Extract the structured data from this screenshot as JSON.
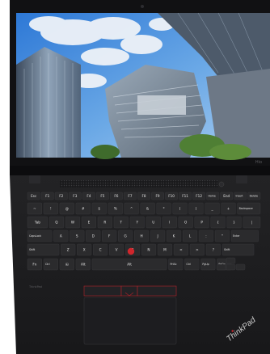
{
  "photo": {
    "subject": "Top view of a black ThinkPad laptop, opened flat, showing the keyboard, TrackPoint and touchpad; the screen shows an upward view of glass skyscrapers against a blue sky with white clouds",
    "colors": {
      "body": "#1c1c1e",
      "key": "#2b2b2d",
      "key_legend": "#e4e4e4",
      "trackpoint": "#d0262c",
      "trackpad_accent": "#b3222a",
      "sky": "#4a8fd8",
      "cloud": "#eef2f8"
    }
  },
  "screen": {
    "bezel_text": "Hio",
    "wallpaper": "skyscrapers-under-blue-sky"
  },
  "keyboard": {
    "function_row": [
      "Esc",
      "F1",
      "F2",
      "F3",
      "F4",
      "F5",
      "F6",
      "F7",
      "F8",
      "F9",
      "F10",
      "F11",
      "F12",
      "Home",
      "End",
      "Insert",
      "Delete"
    ],
    "number_row": [
      "~",
      "!",
      "@",
      "#",
      "$",
      "%",
      "^",
      "&",
      "*",
      "(",
      ")",
      "_",
      "+",
      "Backspace"
    ],
    "number_row_secondary": [
      "`",
      "1",
      "2",
      "3",
      "4",
      "5",
      "6",
      "7",
      "8",
      "9",
      "0",
      "-",
      "="
    ],
    "row_q": [
      "Tab",
      "Q",
      "W",
      "E",
      "R",
      "T",
      "Y",
      "U",
      "I",
      "O",
      "P",
      "{",
      "}",
      "|"
    ],
    "row_a": [
      "CapsLock",
      "A",
      "S",
      "D",
      "F",
      "G",
      "H",
      "J",
      "K",
      "L",
      ":",
      "\"",
      "Enter"
    ],
    "row_z": [
      "Shift",
      "Z",
      "X",
      "C",
      "V",
      "B",
      "N",
      "M",
      "<",
      ">",
      "?",
      "Shift"
    ],
    "bottom_row": [
      "Fn",
      "Ctrl",
      "⊞",
      "Alt",
      "Alt",
      "PrtSc",
      "Ctrl",
      "PgUp",
      "PgDn"
    ]
  },
  "branding": {
    "corner_logo": "ThinkPad",
    "palmrest_text": "ThinkPad"
  }
}
